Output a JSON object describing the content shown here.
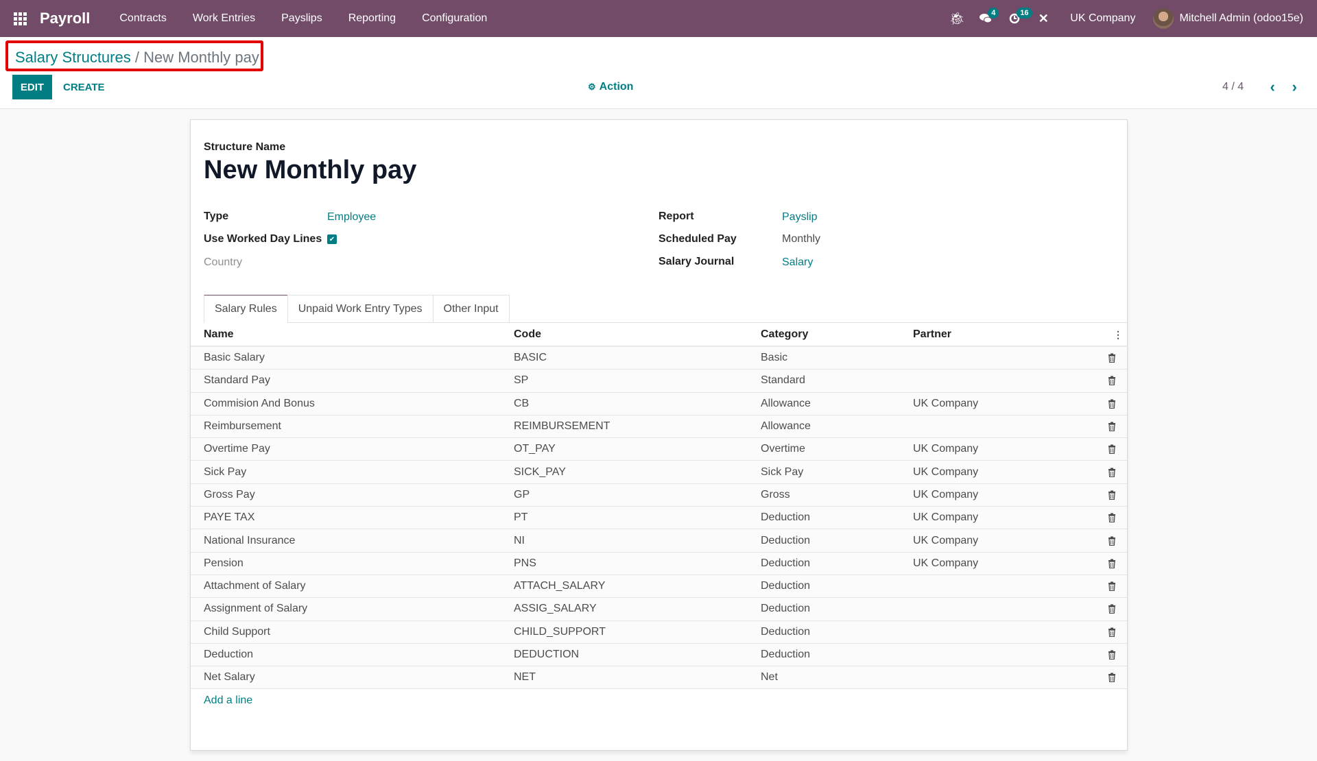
{
  "navbar": {
    "app_name": "Payroll",
    "menu": [
      "Contracts",
      "Work Entries",
      "Payslips",
      "Reporting",
      "Configuration"
    ],
    "icons": {
      "debug": "bug-icon",
      "messages": "chat-icon",
      "activities": "clock-icon",
      "tools": "tools-icon"
    },
    "messages_count": "4",
    "activities_count": "16",
    "company": "UK Company",
    "user": "Mitchell Admin (odoo15e)"
  },
  "breadcrumb": {
    "parent": "Salary Structures",
    "separator": "/",
    "current": "New Monthly pay"
  },
  "toolbar": {
    "edit_label": "EDIT",
    "create_label": "CREATE",
    "action_label": "Action",
    "pager": "4 / 4"
  },
  "form": {
    "name_label": "Structure Name",
    "name": "New Monthly pay",
    "left_fields": [
      {
        "label": "Type",
        "value": "Employee"
      },
      {
        "label": "Use Worked Day Lines",
        "value": true
      },
      {
        "label": "Country",
        "value": ""
      }
    ],
    "right_fields": [
      {
        "label": "Report",
        "value": "Payslip"
      },
      {
        "label": "Scheduled Pay",
        "value": "Monthly"
      },
      {
        "label": "Salary Journal",
        "value": "Salary"
      }
    ],
    "tabs": [
      "Salary Rules",
      "Unpaid Work Entry Types",
      "Other Input"
    ],
    "active_tab": "Salary Rules",
    "table": {
      "columns": [
        "Name",
        "Code",
        "Category",
        "Partner"
      ],
      "rows": [
        [
          "Basic Salary",
          "BASIC",
          "Basic",
          ""
        ],
        [
          "Standard Pay",
          "SP",
          "Standard",
          ""
        ],
        [
          "Commision And Bonus",
          "CB",
          "Allowance",
          "UK Company"
        ],
        [
          "Reimbursement",
          "REIMBURSEMENT",
          "Allowance",
          ""
        ],
        [
          "Overtime Pay",
          "OT_PAY",
          "Overtime",
          "UK Company"
        ],
        [
          "Sick Pay",
          "SICK_PAY",
          "Sick Pay",
          "UK Company"
        ],
        [
          "Gross Pay",
          "GP",
          "Gross",
          "UK Company"
        ],
        [
          "PAYE TAX",
          "PT",
          "Deduction",
          "UK Company"
        ],
        [
          "National Insurance",
          "NI",
          "Deduction",
          "UK Company"
        ],
        [
          "Pension",
          "PNS",
          "Deduction",
          "UK Company"
        ],
        [
          "Attachment of Salary",
          "ATTACH_SALARY",
          "Deduction",
          ""
        ],
        [
          "Assignment of Salary",
          "ASSIG_SALARY",
          "Deduction",
          ""
        ],
        [
          "Child Support",
          "CHILD_SUPPORT",
          "Deduction",
          ""
        ],
        [
          "Deduction",
          "DEDUCTION",
          "Deduction",
          ""
        ],
        [
          "Net Salary",
          "NET",
          "Net",
          ""
        ]
      ],
      "add_line_label": "Add a line"
    }
  }
}
